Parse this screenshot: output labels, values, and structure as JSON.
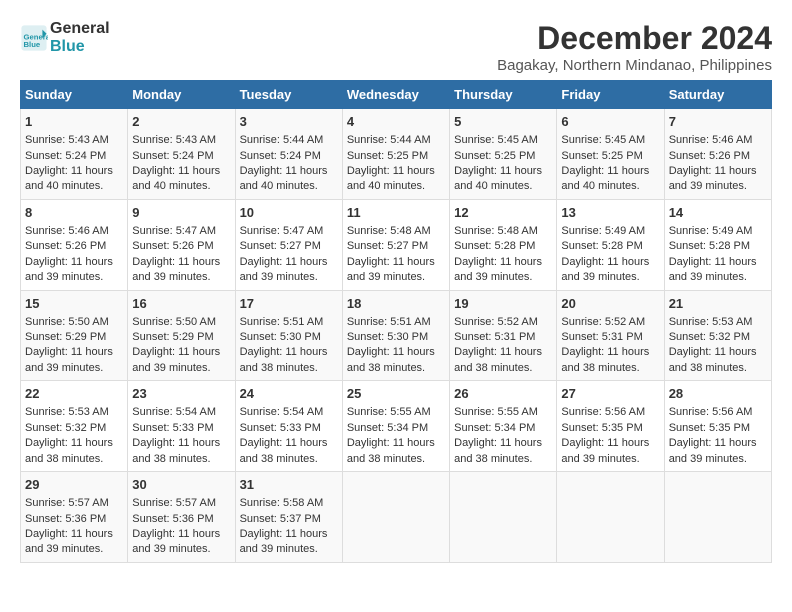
{
  "header": {
    "logo_line1": "General",
    "logo_line2": "Blue",
    "title": "December 2024",
    "subtitle": "Bagakay, Northern Mindanao, Philippines"
  },
  "weekdays": [
    "Sunday",
    "Monday",
    "Tuesday",
    "Wednesday",
    "Thursday",
    "Friday",
    "Saturday"
  ],
  "weeks": [
    [
      {
        "day": "1",
        "sunrise": "5:43 AM",
        "sunset": "5:24 PM",
        "daylight": "11 hours and 40 minutes."
      },
      {
        "day": "2",
        "sunrise": "5:43 AM",
        "sunset": "5:24 PM",
        "daylight": "11 hours and 40 minutes."
      },
      {
        "day": "3",
        "sunrise": "5:44 AM",
        "sunset": "5:24 PM",
        "daylight": "11 hours and 40 minutes."
      },
      {
        "day": "4",
        "sunrise": "5:44 AM",
        "sunset": "5:25 PM",
        "daylight": "11 hours and 40 minutes."
      },
      {
        "day": "5",
        "sunrise": "5:45 AM",
        "sunset": "5:25 PM",
        "daylight": "11 hours and 40 minutes."
      },
      {
        "day": "6",
        "sunrise": "5:45 AM",
        "sunset": "5:25 PM",
        "daylight": "11 hours and 40 minutes."
      },
      {
        "day": "7",
        "sunrise": "5:46 AM",
        "sunset": "5:26 PM",
        "daylight": "11 hours and 39 minutes."
      }
    ],
    [
      {
        "day": "8",
        "sunrise": "5:46 AM",
        "sunset": "5:26 PM",
        "daylight": "11 hours and 39 minutes."
      },
      {
        "day": "9",
        "sunrise": "5:47 AM",
        "sunset": "5:26 PM",
        "daylight": "11 hours and 39 minutes."
      },
      {
        "day": "10",
        "sunrise": "5:47 AM",
        "sunset": "5:27 PM",
        "daylight": "11 hours and 39 minutes."
      },
      {
        "day": "11",
        "sunrise": "5:48 AM",
        "sunset": "5:27 PM",
        "daylight": "11 hours and 39 minutes."
      },
      {
        "day": "12",
        "sunrise": "5:48 AM",
        "sunset": "5:28 PM",
        "daylight": "11 hours and 39 minutes."
      },
      {
        "day": "13",
        "sunrise": "5:49 AM",
        "sunset": "5:28 PM",
        "daylight": "11 hours and 39 minutes."
      },
      {
        "day": "14",
        "sunrise": "5:49 AM",
        "sunset": "5:28 PM",
        "daylight": "11 hours and 39 minutes."
      }
    ],
    [
      {
        "day": "15",
        "sunrise": "5:50 AM",
        "sunset": "5:29 PM",
        "daylight": "11 hours and 39 minutes."
      },
      {
        "day": "16",
        "sunrise": "5:50 AM",
        "sunset": "5:29 PM",
        "daylight": "11 hours and 39 minutes."
      },
      {
        "day": "17",
        "sunrise": "5:51 AM",
        "sunset": "5:30 PM",
        "daylight": "11 hours and 38 minutes."
      },
      {
        "day": "18",
        "sunrise": "5:51 AM",
        "sunset": "5:30 PM",
        "daylight": "11 hours and 38 minutes."
      },
      {
        "day": "19",
        "sunrise": "5:52 AM",
        "sunset": "5:31 PM",
        "daylight": "11 hours and 38 minutes."
      },
      {
        "day": "20",
        "sunrise": "5:52 AM",
        "sunset": "5:31 PM",
        "daylight": "11 hours and 38 minutes."
      },
      {
        "day": "21",
        "sunrise": "5:53 AM",
        "sunset": "5:32 PM",
        "daylight": "11 hours and 38 minutes."
      }
    ],
    [
      {
        "day": "22",
        "sunrise": "5:53 AM",
        "sunset": "5:32 PM",
        "daylight": "11 hours and 38 minutes."
      },
      {
        "day": "23",
        "sunrise": "5:54 AM",
        "sunset": "5:33 PM",
        "daylight": "11 hours and 38 minutes."
      },
      {
        "day": "24",
        "sunrise": "5:54 AM",
        "sunset": "5:33 PM",
        "daylight": "11 hours and 38 minutes."
      },
      {
        "day": "25",
        "sunrise": "5:55 AM",
        "sunset": "5:34 PM",
        "daylight": "11 hours and 38 minutes."
      },
      {
        "day": "26",
        "sunrise": "5:55 AM",
        "sunset": "5:34 PM",
        "daylight": "11 hours and 38 minutes."
      },
      {
        "day": "27",
        "sunrise": "5:56 AM",
        "sunset": "5:35 PM",
        "daylight": "11 hours and 39 minutes."
      },
      {
        "day": "28",
        "sunrise": "5:56 AM",
        "sunset": "5:35 PM",
        "daylight": "11 hours and 39 minutes."
      }
    ],
    [
      {
        "day": "29",
        "sunrise": "5:57 AM",
        "sunset": "5:36 PM",
        "daylight": "11 hours and 39 minutes."
      },
      {
        "day": "30",
        "sunrise": "5:57 AM",
        "sunset": "5:36 PM",
        "daylight": "11 hours and 39 minutes."
      },
      {
        "day": "31",
        "sunrise": "5:58 AM",
        "sunset": "5:37 PM",
        "daylight": "11 hours and 39 minutes."
      },
      null,
      null,
      null,
      null
    ]
  ]
}
